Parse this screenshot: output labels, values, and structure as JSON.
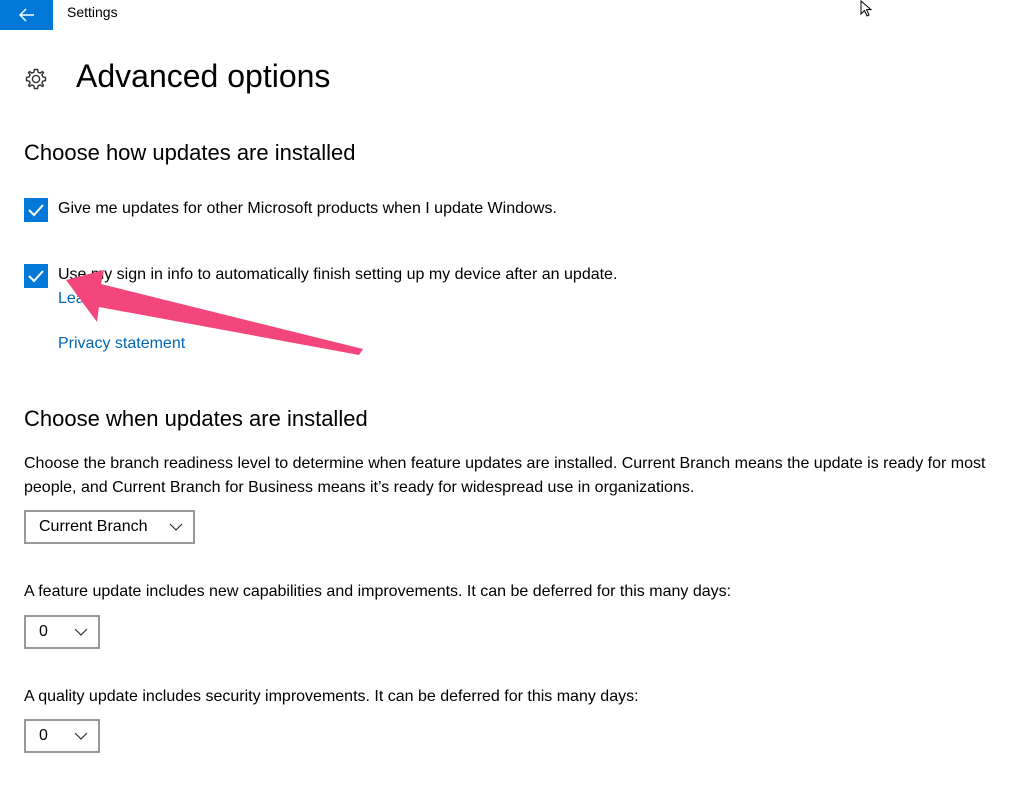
{
  "window": {
    "title": "Settings",
    "back_icon": "arrow-left-icon"
  },
  "header": {
    "icon": "gear-icon",
    "title": "Advanced options"
  },
  "install_section": {
    "title": "Choose how updates are installed",
    "options": [
      {
        "label": "Give me updates for other Microsoft products when I update Windows.",
        "checked": true
      },
      {
        "label": "Use my sign in info to automatically finish setting up my device after an update.",
        "checked": true
      }
    ],
    "learn_more_label": "Learn more",
    "privacy_label": "Privacy statement"
  },
  "when_section": {
    "title": "Choose when updates are installed",
    "branch_description": "Choose the branch readiness level to determine when feature updates are installed. Current Branch means the update is ready for most people, and Current Branch for Business means it’s ready for widespread use in organizations.",
    "branch_select_value": "Current Branch",
    "feature_description": "A feature update includes new capabilities and improvements. It can be deferred for this many days:",
    "feature_select_value": "0",
    "quality_description": "A quality update includes security improvements. It can be deferred for this many days:",
    "quality_select_value": "0"
  },
  "colors": {
    "accent": "#0078d7",
    "link": "#0067b8",
    "annotation_arrow": "#f2467c"
  }
}
